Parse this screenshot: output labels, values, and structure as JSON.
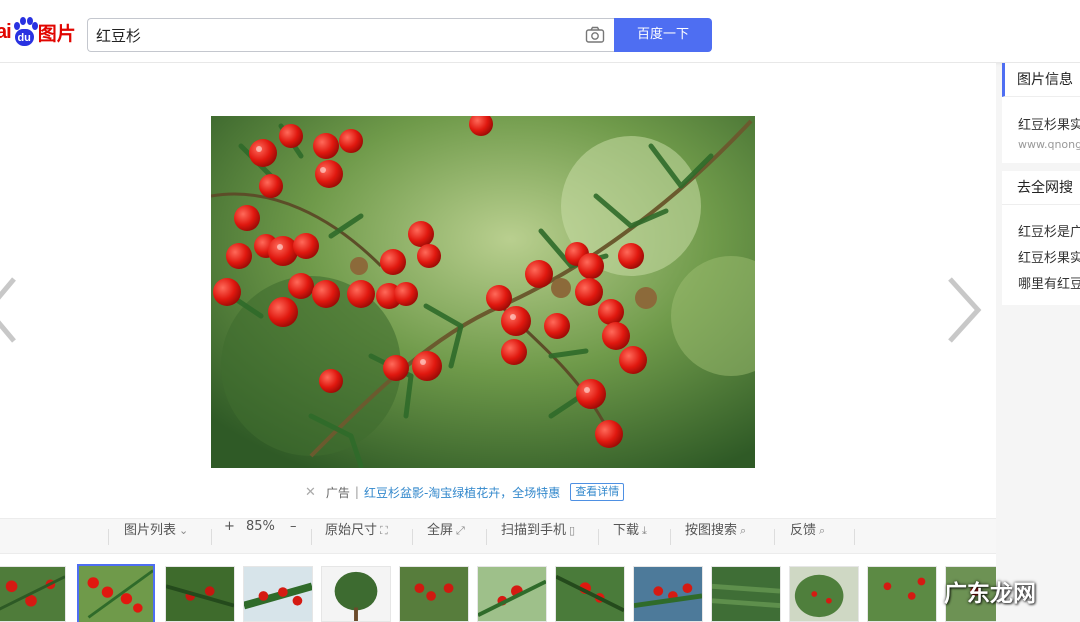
{
  "header": {
    "logo_ai": "ai",
    "logo_du": "du",
    "logo_pic": "图片",
    "search_value": "红豆杉",
    "search_button": "百度一下",
    "camera_icon": "camera-icon"
  },
  "ad": {
    "close": "✕",
    "label": "广告",
    "link_text": "红豆杉盆影-淘宝绿植花卉，全场特惠",
    "detail_button": "查看详情"
  },
  "toolbar": {
    "list": "图片列表",
    "zoom_in": "+",
    "zoom_level": "85%",
    "zoom_out": "–",
    "original_size": "原始尺寸",
    "fullscreen": "全屏",
    "scan_phone": "扫描到手机",
    "download": "下载",
    "search_by_image": "按图搜索",
    "feedback": "反馈"
  },
  "sidebar": {
    "info_title": "图片信息",
    "info_item": "红豆杉果实",
    "info_source": "www.qnong",
    "search_title": "去全网搜",
    "links": [
      "红豆杉是广",
      "红豆杉果实",
      "哪里有红豆"
    ]
  },
  "watermark": "广东龙网",
  "colors": {
    "accent": "#4e6ef2",
    "logo_red": "#e10601",
    "logo_blue": "#2932e1",
    "link": "#3388cc"
  }
}
